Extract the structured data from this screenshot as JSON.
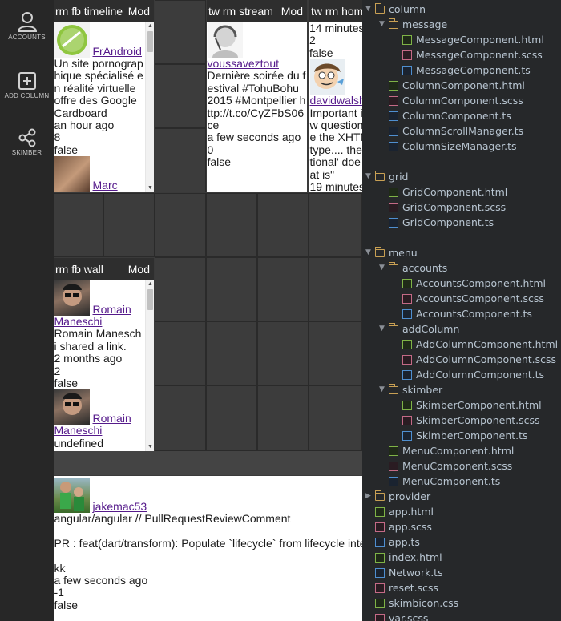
{
  "menu": {
    "accounts_label": "ACCOUNTS",
    "add_column_label": "ADD COLUMN",
    "skimber_label": "SKIMBER"
  },
  "columns": {
    "timeline": {
      "title": "rm fb timeline",
      "mod": "Mod",
      "messages": [
        {
          "user": "FrAndroid",
          "lines": [
            "Un site pornograp",
            "hique spécialisé e",
            "n réalité virtuelle",
            "offre des Google",
            "Cardboard",
            "an hour ago",
            "8",
            "false"
          ]
        },
        {
          "user": "Marc",
          "lines": []
        }
      ]
    },
    "stream": {
      "title": "tw rm stream",
      "mod": "Mod",
      "messages": [
        {
          "user": "voussaveztout",
          "lines": [
            "Dernière soirée du f",
            "estival #TohuBohu",
            "2015 #Montpellier h",
            "ttp://t.co/CyZFbS06",
            "ce",
            "a few seconds ago",
            "0",
            "false"
          ]
        }
      ]
    },
    "home": {
      "title": "tw rm hom",
      "top_lines": [
        "14 minutes",
        "2",
        "false"
      ],
      "messages": [
        {
          "user": "davidwalsh",
          "lines": [
            "Important i",
            "w question",
            "e the XHTM",
            "type.... the",
            "tional' doe",
            "at is\"",
            "19 minutes"
          ]
        }
      ]
    },
    "wall": {
      "title": "rm fb wall",
      "mod": "Mod",
      "messages": [
        {
          "user": "Romain",
          "user2": "Maneschi",
          "lines": [
            "Romain Manesch",
            "i shared a link.",
            "2 months ago",
            "2",
            "false"
          ]
        },
        {
          "user": "Romain",
          "user2": "Maneschi",
          "lines": [
            "undefined"
          ]
        }
      ]
    },
    "wide": {
      "messages": [
        {
          "user": "jakemac53",
          "lines": [
            "angular/angular // PullRequestReviewComment",
            "",
            "PR : feat(dart/transform): Populate `lifecycle` from lifecycle inter",
            "",
            "kk",
            "a few seconds ago",
            "-1",
            "false"
          ]
        }
      ]
    }
  },
  "tree": [
    {
      "name": "column",
      "type": "folder",
      "open": true,
      "depth": 0
    },
    {
      "name": "message",
      "type": "folder",
      "open": true,
      "depth": 1
    },
    {
      "name": "MessageComponent.html",
      "type": "html",
      "depth": 2
    },
    {
      "name": "MessageComponent.scss",
      "type": "scss",
      "depth": 2
    },
    {
      "name": "MessageComponent.ts",
      "type": "ts",
      "depth": 2
    },
    {
      "name": "ColumnComponent.html",
      "type": "html",
      "depth": 1
    },
    {
      "name": "ColumnComponent.scss",
      "type": "scss",
      "depth": 1
    },
    {
      "name": "ColumnComponent.ts",
      "type": "ts",
      "depth": 1
    },
    {
      "name": "ColumnScrollManager.ts",
      "type": "ts",
      "depth": 1
    },
    {
      "name": "ColumnSizeManager.ts",
      "type": "ts",
      "depth": 1
    },
    {
      "name": "grid",
      "type": "folder",
      "open": true,
      "depth": 0,
      "gap": true
    },
    {
      "name": "GridComponent.html",
      "type": "html",
      "depth": 1
    },
    {
      "name": "GridComponent.scss",
      "type": "scss",
      "depth": 1
    },
    {
      "name": "GridComponent.ts",
      "type": "ts",
      "depth": 1
    },
    {
      "name": "menu",
      "type": "folder",
      "open": true,
      "depth": 0,
      "gap": true
    },
    {
      "name": "accounts",
      "type": "folder",
      "open": true,
      "depth": 1
    },
    {
      "name": "AccountsComponent.html",
      "type": "html",
      "depth": 2
    },
    {
      "name": "AccountsComponent.scss",
      "type": "scss",
      "depth": 2
    },
    {
      "name": "AccountsComponent.ts",
      "type": "ts",
      "depth": 2
    },
    {
      "name": "addColumn",
      "type": "folder",
      "open": true,
      "depth": 1
    },
    {
      "name": "AddColumnComponent.html",
      "type": "html",
      "depth": 2
    },
    {
      "name": "AddColumnComponent.scss",
      "type": "scss",
      "depth": 2
    },
    {
      "name": "AddColumnComponent.ts",
      "type": "ts",
      "depth": 2
    },
    {
      "name": "skimber",
      "type": "folder",
      "open": true,
      "depth": 1
    },
    {
      "name": "SkimberComponent.html",
      "type": "html",
      "depth": 2
    },
    {
      "name": "SkimberComponent.scss",
      "type": "scss",
      "depth": 2
    },
    {
      "name": "SkimberComponent.ts",
      "type": "ts",
      "depth": 2
    },
    {
      "name": "MenuComponent.html",
      "type": "html",
      "depth": 1
    },
    {
      "name": "MenuComponent.scss",
      "type": "scss",
      "depth": 1
    },
    {
      "name": "MenuComponent.ts",
      "type": "ts",
      "depth": 1
    },
    {
      "name": "provider",
      "type": "folder",
      "open": false,
      "depth": 0
    },
    {
      "name": "app.html",
      "type": "html",
      "depth": 0
    },
    {
      "name": "app.scss",
      "type": "scss",
      "depth": 0
    },
    {
      "name": "app.ts",
      "type": "ts",
      "depth": 0
    },
    {
      "name": "index.html",
      "type": "html",
      "depth": 0
    },
    {
      "name": "Network.ts",
      "type": "ts",
      "depth": 0
    },
    {
      "name": "reset.scss",
      "type": "scss",
      "depth": 0
    },
    {
      "name": "skimbicon.css",
      "type": "css",
      "depth": 0
    },
    {
      "name": "var.scss",
      "type": "scss",
      "depth": 0
    }
  ]
}
